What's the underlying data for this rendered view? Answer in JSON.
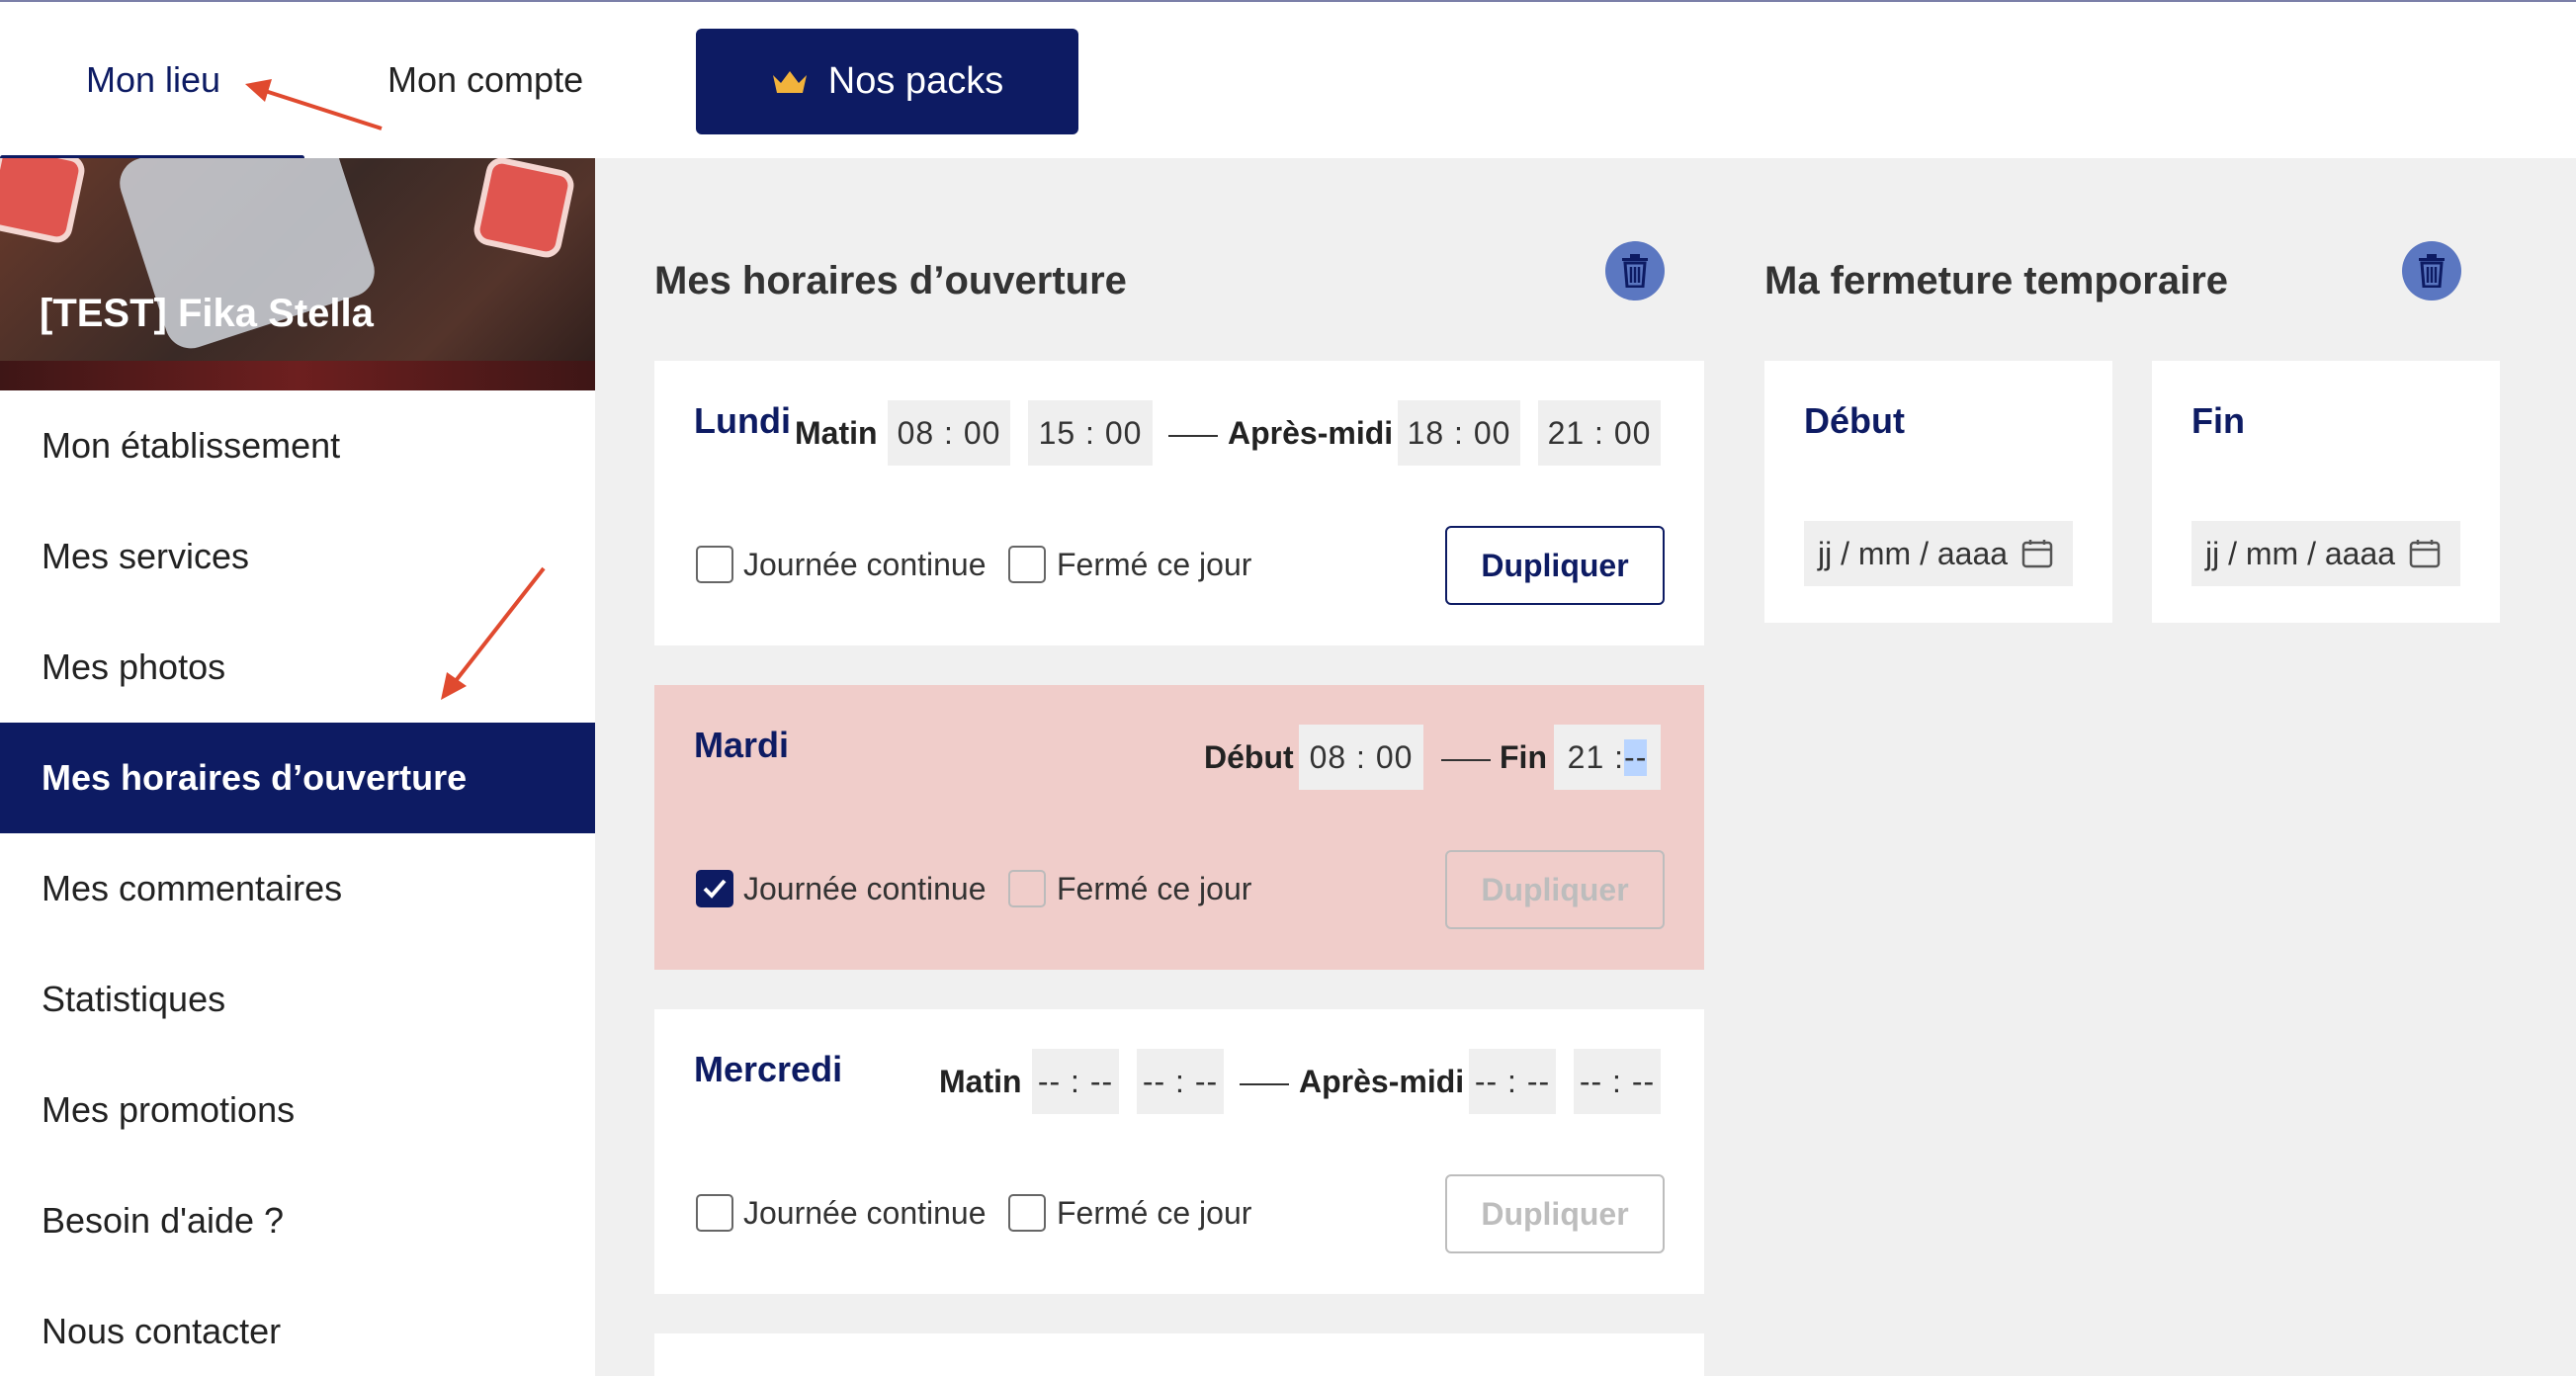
{
  "topnav": {
    "mon_lieu": "Mon lieu",
    "mon_compte": "Mon compte",
    "packs_label": "Nos packs"
  },
  "sidebar": {
    "venue_name": "[TEST] Fika Stella",
    "items": [
      {
        "label": "Mon établissement",
        "active": false
      },
      {
        "label": "Mes services",
        "active": false
      },
      {
        "label": "Mes photos",
        "active": false
      },
      {
        "label": "Mes horaires d’ouverture",
        "active": true
      },
      {
        "label": "Mes commentaires",
        "active": false
      },
      {
        "label": "Statistiques",
        "active": false
      },
      {
        "label": "Mes promotions",
        "active": false
      },
      {
        "label": "Besoin d'aide ?",
        "active": false
      },
      {
        "label": "Nous contacter",
        "active": false
      }
    ]
  },
  "hours": {
    "title": "Mes horaires d’ouverture",
    "labels": {
      "matin": "Matin",
      "apres_midi": "Après-midi",
      "debut": "Début",
      "fin": "Fin",
      "journee_continue": "Journée continue",
      "ferme_ce_jour": "Fermé ce jour",
      "dupliquer": "Dupliquer"
    },
    "days": [
      {
        "name": "Lundi",
        "morning_start": "08 : 00",
        "morning_end": "15 : 00",
        "afternoon_start": "18 : 00",
        "afternoon_end": "21 : 00",
        "journee_continue": false,
        "ferme": false
      },
      {
        "name": "Mardi",
        "start": "08 : 00",
        "end_hours": "21 :",
        "end_minutes": "--",
        "journee_continue": true,
        "ferme": false
      },
      {
        "name": "Mercredi",
        "morning_start": "-- : --",
        "morning_end": "-- : --",
        "afternoon_start": "-- : --",
        "afternoon_end": "-- : --",
        "journee_continue": false,
        "ferme": false
      }
    ]
  },
  "closure": {
    "title": "Ma fermeture temporaire",
    "start_label": "Début",
    "end_label": "Fin",
    "date_placeholder": "jj / mm / aaaa"
  },
  "colors": {
    "navy": "#0d1b63",
    "closed_day_bg": "#f0cdca",
    "trash_blue": "#5b77c1",
    "annotation_red": "#e04a2f"
  },
  "icons": [
    "crown-icon",
    "trash-icon",
    "calendar-icon",
    "checkmark-icon"
  ]
}
